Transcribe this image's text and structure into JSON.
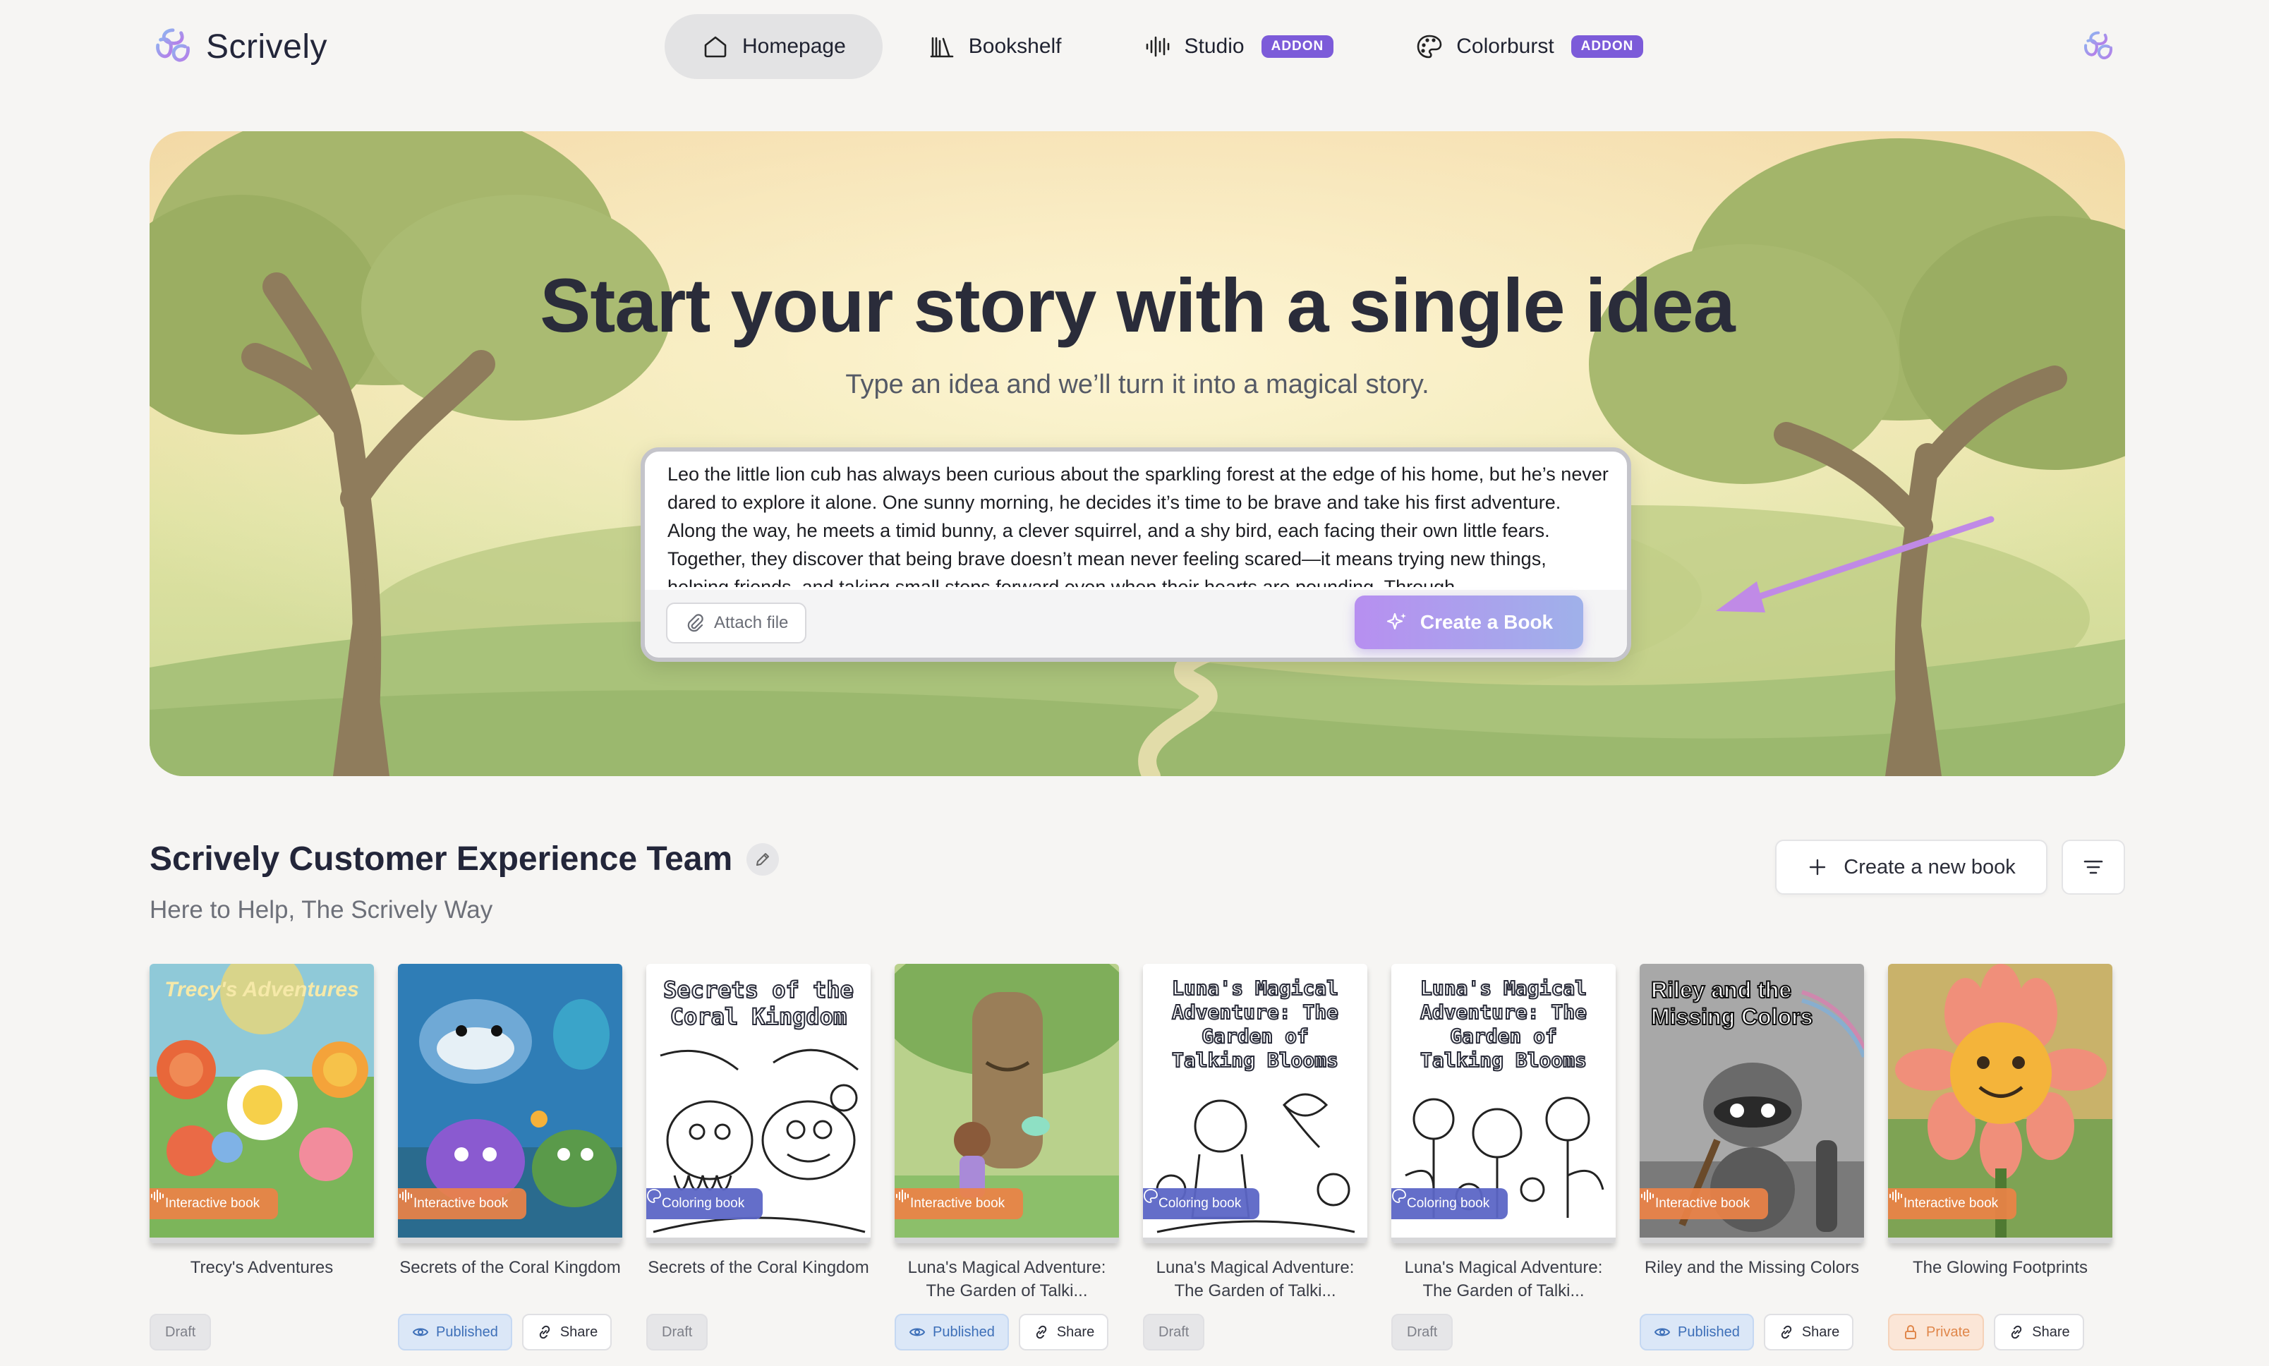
{
  "brand": {
    "name": "Scrively"
  },
  "nav": {
    "items": [
      {
        "label": "Homepage"
      },
      {
        "label": "Bookshelf"
      },
      {
        "label": "Studio",
        "badge": "ADDON"
      },
      {
        "label": "Colorburst",
        "badge": "ADDON"
      }
    ]
  },
  "hero": {
    "title": "Start your story with a single idea",
    "subtitle": "Type an idea and we’ll turn it into a magical story.",
    "prompt_value": "Leo the little lion cub has always been curious about the sparkling forest at the edge of his home, but he’s never dared to explore it alone. One sunny morning, he decides it’s time to be brave and take his first adventure. Along the way, he meets a timid bunny, a clever squirrel, and a shy bird, each facing their own little fears. Together, they discover that being brave doesn’t mean never feeling scared—it means trying new things, helping friends, and taking small steps forward even when their hearts are pounding. Through",
    "attach_label": "Attach file",
    "create_label": "Create a Book"
  },
  "workspace": {
    "title": "Scrively Customer Experience Team",
    "subtitle": "Here to Help, The Scrively Way",
    "new_book_label": "Create a new book"
  },
  "books": [
    {
      "title": "Trecy's Adventures",
      "cover_text": "Trecy's Adventures",
      "tag": "Interactive book",
      "status": "Draft"
    },
    {
      "title": "Secrets of the Coral Kingdom",
      "cover_text": "",
      "tag": "Interactive book",
      "status": "Published",
      "share": "Share"
    },
    {
      "title": "Secrets of the Coral Kingdom",
      "cover_text": "Secrets of the Coral Kingdom",
      "tag": "Coloring book",
      "status": "Draft"
    },
    {
      "title": "Luna's Magical Adventure: The Garden of Talki...",
      "cover_text": "",
      "tag": "Interactive book",
      "status": "Published",
      "share": "Share"
    },
    {
      "title": "Luna's Magical Adventure: The Garden of Talki...",
      "cover_text": "Luna's Magical Adventure: The Garden of Talking Blooms",
      "tag": "Coloring book",
      "status": "Draft"
    },
    {
      "title": "Luna's Magical Adventure: The Garden of Talki...",
      "cover_text": "Luna's Magical Adventure: The Garden of Talking Blooms",
      "tag": "Coloring book",
      "status": "Draft"
    },
    {
      "title": "Riley and the Missing Colors",
      "cover_text": "Riley and the Missing Colors",
      "tag": "Interactive book",
      "status": "Published",
      "share": "Share"
    },
    {
      "title": "The Glowing Footprints",
      "cover_text": "",
      "tag": "Interactive book",
      "status": "Private",
      "share": "Share"
    }
  ],
  "colors": {
    "accent": "#7c5bd9",
    "interactive_tag": "#ec8246",
    "coloring_tag": "#5c66c6"
  }
}
